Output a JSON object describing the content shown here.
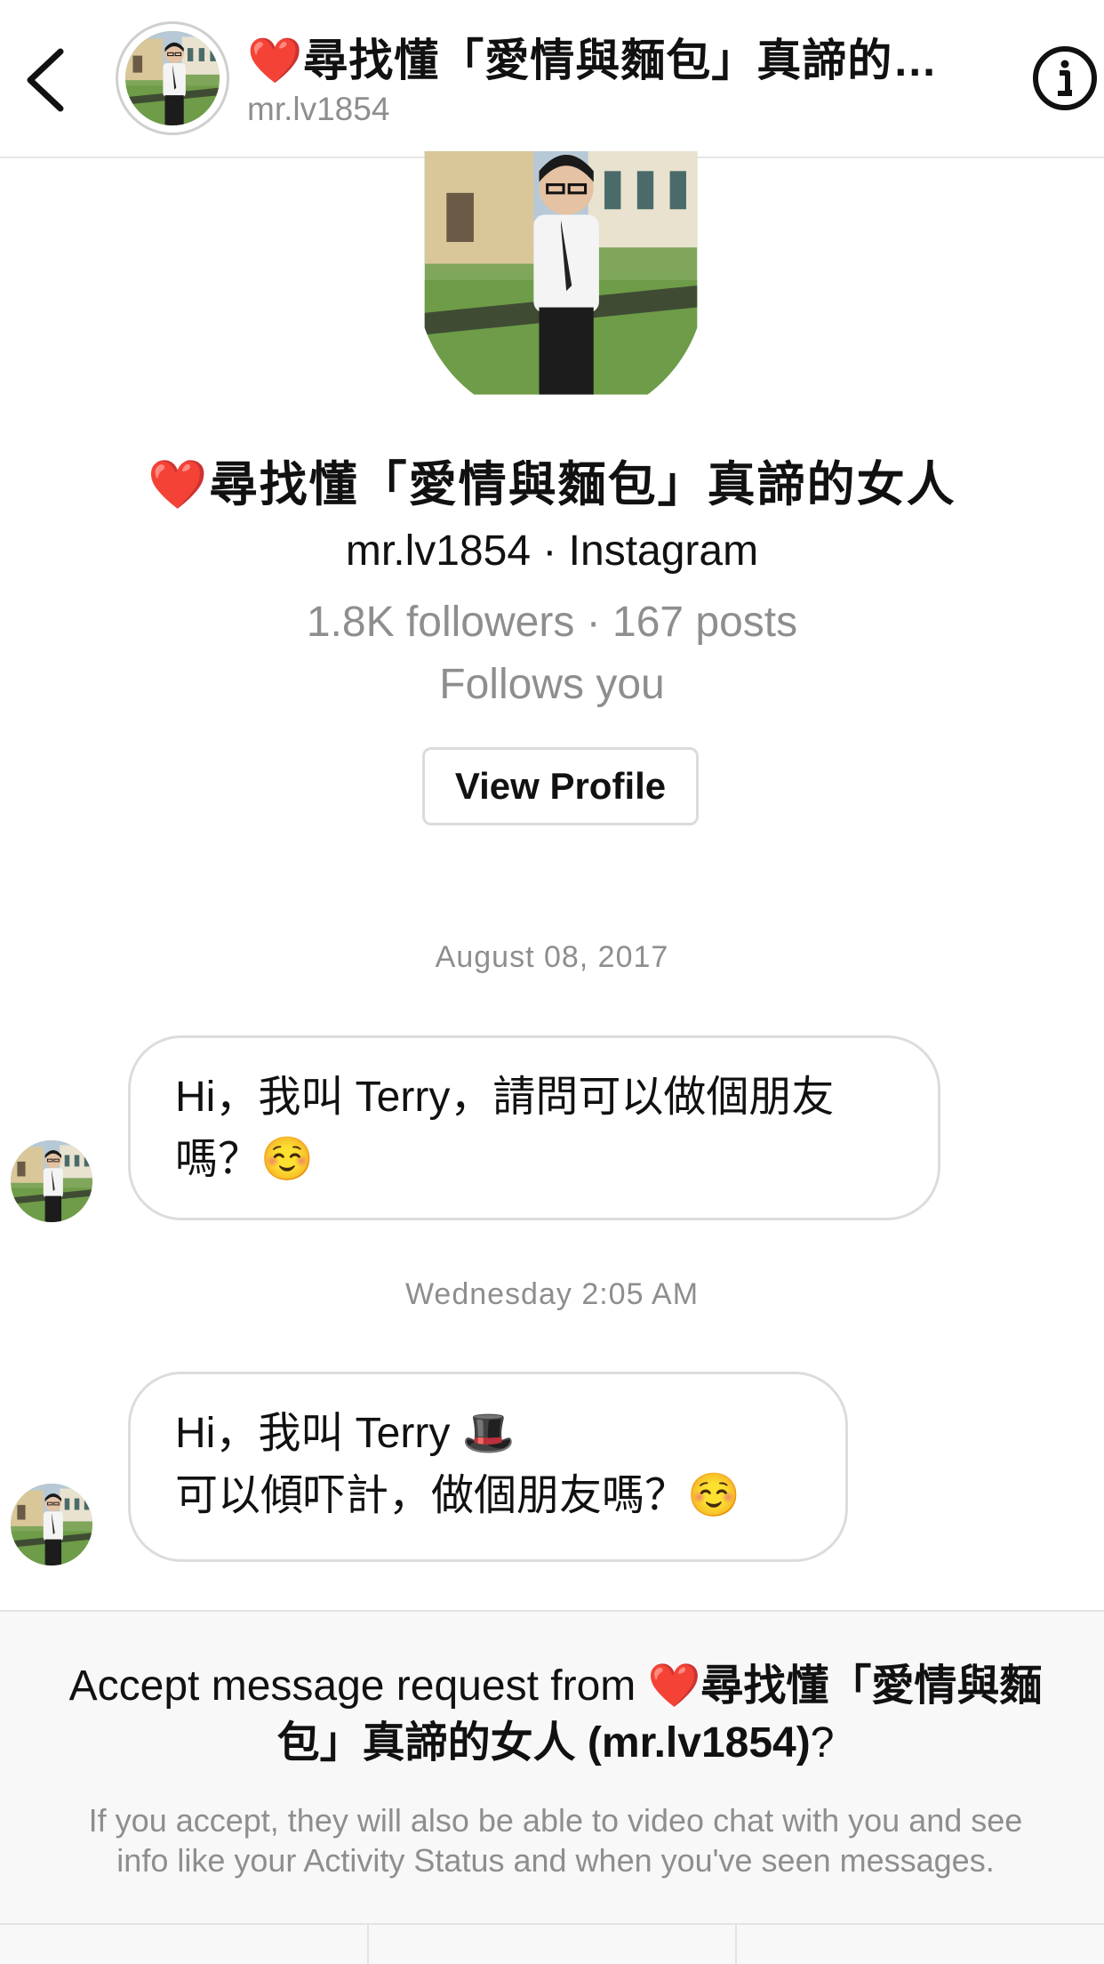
{
  "header": {
    "title": "❤️尋找懂「愛情與麵包」真諦的女人",
    "username": "mr.lv1854",
    "back_icon": "chevron-left-icon",
    "info_icon": "info-circle-icon"
  },
  "profile": {
    "name": "❤️尋找懂「愛情與麵包」真諦的女人",
    "handle_line": "mr.lv1854 · Instagram",
    "stats": "1.8K followers · 167 posts",
    "follows": "Follows you",
    "view_profile_label": "View Profile"
  },
  "messages": [
    {
      "timestamp": "August 08, 2017",
      "lines": [
        "Hi，我叫 Terry，請問可以做個朋友",
        "嗎？☺️"
      ]
    },
    {
      "timestamp": "Wednesday 2:05 AM",
      "lines": [
        "Hi，我叫 Terry 🎩",
        "可以傾吓計，做個朋友嗎？☺️"
      ]
    }
  ],
  "request": {
    "title_prefix": "Accept message request from ",
    "title_name_line1": "❤️尋找懂「愛情與麵",
    "title_name_line2": "包」真諦的女人 (mr.lv1854)",
    "title_suffix": "?",
    "body_line1": "If you accept, they will also be able to video chat with you and see",
    "body_line2": "info like your Activity Status and when you've seen messages."
  },
  "colors": {
    "secondary_text": "#8e8e8e",
    "bubble_border": "#dcdcdc",
    "footer_bg": "#f8f8f8"
  }
}
